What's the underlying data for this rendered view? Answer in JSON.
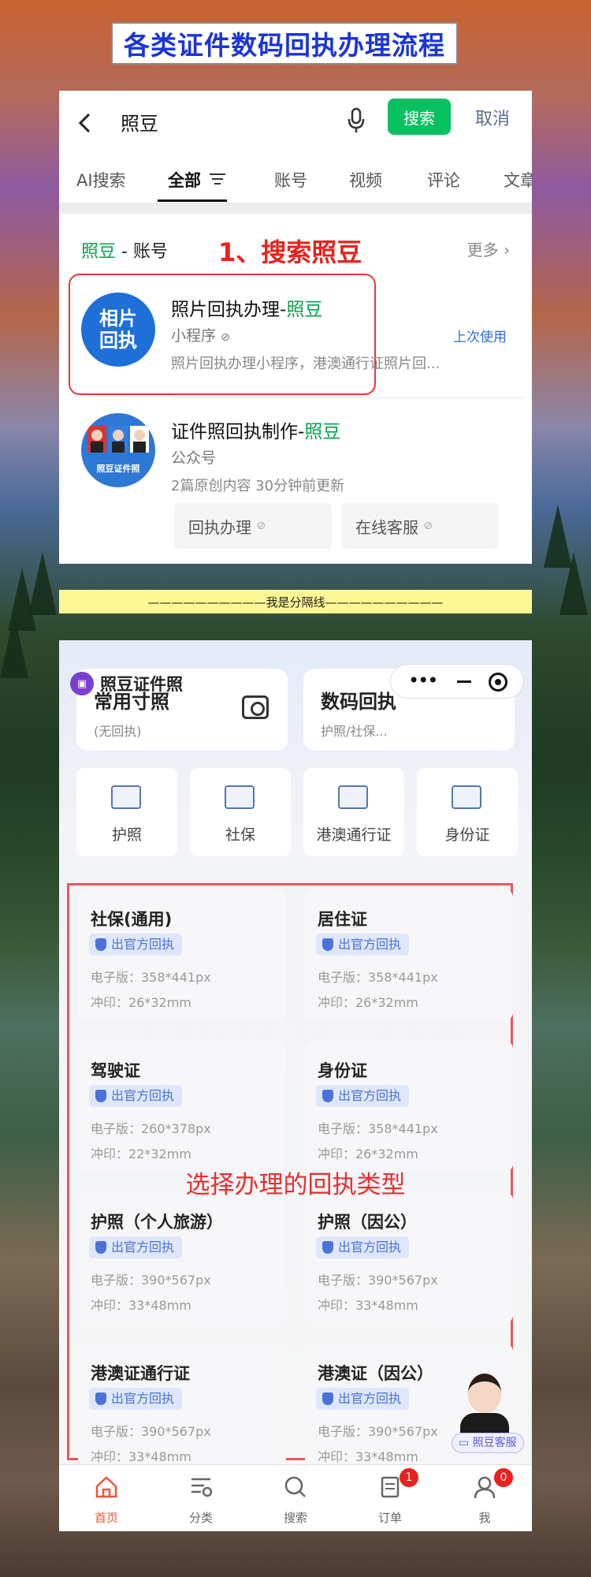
{
  "banner": {
    "title": "各类证件数码回执办理流程"
  },
  "search": {
    "query": "照豆",
    "search_button": "搜索",
    "cancel_button": "取消"
  },
  "tabs": [
    "AI搜索",
    "全部",
    "账号",
    "视频",
    "评论",
    "文章"
  ],
  "results": {
    "section_highlight": "照豆",
    "section_rest": " - 账号",
    "more": "更多",
    "step_annotation": "1、搜索照豆",
    "items": [
      {
        "avatar_text_line1": "相片",
        "avatar_text_line2": "回执",
        "title_prefix": "照片回执办理-",
        "title_highlight": "照豆",
        "type": "小程序",
        "last_used": "上次使用",
        "desc": "照片回执办理小程序，港澳通行证照片回..."
      },
      {
        "avatar_caption": "照豆证件照",
        "title_prefix": "证件照回执制作-",
        "title_highlight": "照豆",
        "type": "公众号",
        "desc": "2篇原创内容  30分钟前更新",
        "buttons": [
          "回执办理",
          "在线客服"
        ]
      }
    ]
  },
  "separator": "——————————我是分隔线——————————",
  "miniprogram": {
    "brand": "照豆证件照",
    "top_cards": [
      {
        "title": "常用寸照",
        "sub": "(无回执)"
      },
      {
        "title": "数码回执",
        "sub": "护照/社保..."
      }
    ],
    "doc_tiles": [
      "护照",
      "社保",
      "港澳通行证",
      "身份证"
    ],
    "badge_text": "出官方回执",
    "cert_cards": [
      {
        "name": "社保(通用)",
        "elec": "电子版：358*441px",
        "print": "冲印：26*32mm"
      },
      {
        "name": "居住证",
        "elec": "电子版：358*441px",
        "print": "冲印：26*32mm"
      },
      {
        "name": "驾驶证",
        "elec": "电子版：260*378px",
        "print": "冲印：22*32mm"
      },
      {
        "name": "身份证",
        "elec": "电子版：358*441px",
        "print": "冲印：26*32mm"
      },
      {
        "name": "护照（个人旅游）",
        "elec": "电子版：390*567px",
        "print": "冲印：33*48mm"
      },
      {
        "name": "护照（因公）",
        "elec": "电子版：390*567px",
        "print": "冲印：33*48mm"
      },
      {
        "name": "港澳证通行证",
        "elec": "电子版：390*567px",
        "print": "冲印：33*48mm"
      },
      {
        "name": "港澳证（因公）",
        "elec": "电子版：390*567px",
        "print": "冲印：33*48mm"
      }
    ],
    "overlay_annotation": "选择办理的回执类型",
    "service_tag": "照豆客服",
    "nav": [
      {
        "label": "首页",
        "badge": ""
      },
      {
        "label": "分类",
        "badge": ""
      },
      {
        "label": "搜索",
        "badge": ""
      },
      {
        "label": "订单",
        "badge": "1"
      },
      {
        "label": "我",
        "badge": "0"
      }
    ]
  },
  "colors": {
    "brand_green": "#07c160",
    "highlight_green": "#07a04a",
    "annotation_red": "#e8221c",
    "title_blue": "#1a35d8",
    "separator_yellow": "#fef894",
    "badge_blue": "#4a72d8",
    "active_nav": "#f0543c"
  }
}
